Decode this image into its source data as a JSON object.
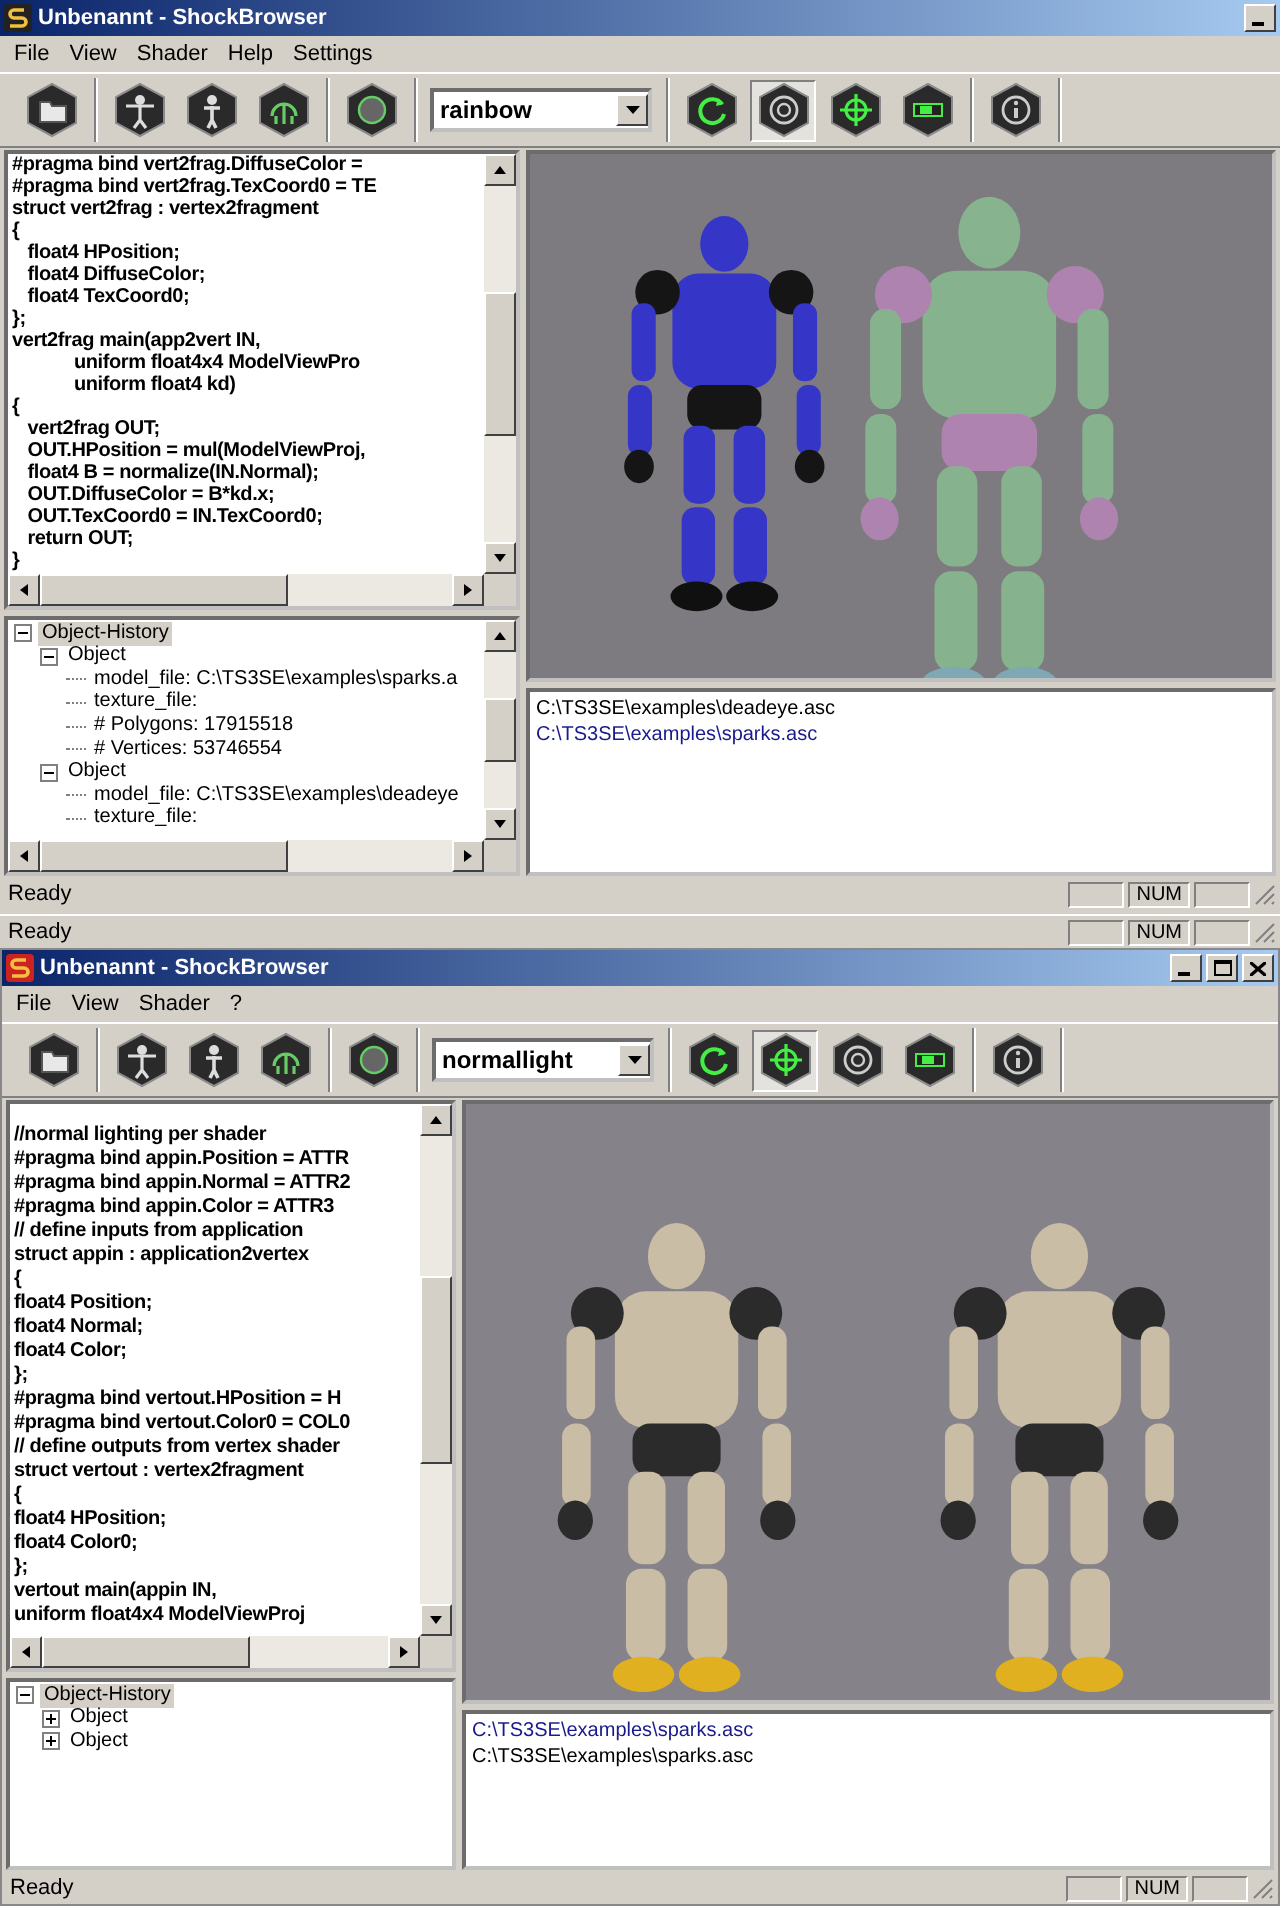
{
  "windows": [
    {
      "title": "Unbenannt - ShockBrowser",
      "caption_buttons": [
        {
          "kind": "minimize"
        }
      ],
      "menu": [
        "File",
        "View",
        "Shader",
        "Help",
        "Settings"
      ],
      "toolbar": [
        {
          "kind": "buttons",
          "buttons": [
            {
              "kind": "folder",
              "pressed": false
            }
          ]
        },
        {
          "kind": "buttons",
          "buttons": [
            {
              "kind": "spread-figure",
              "pressed": false
            },
            {
              "kind": "figure",
              "pressed": false
            },
            {
              "kind": "helmet",
              "pressed": false
            }
          ]
        },
        {
          "kind": "buttons",
          "buttons": [
            {
              "kind": "sphere",
              "pressed": false
            }
          ]
        },
        {
          "kind": "dropdown",
          "value": "rainbow"
        },
        {
          "kind": "buttons",
          "buttons": [
            {
              "kind": "rotate",
              "pressed": false
            },
            {
              "kind": "ring",
              "pressed": true
            },
            {
              "kind": "crosshair",
              "pressed": false
            },
            {
              "kind": "slider",
              "pressed": false
            }
          ]
        },
        {
          "kind": "buttons",
          "buttons": [
            {
              "kind": "info",
              "pressed": false
            }
          ]
        }
      ],
      "code": [
        "#pragma bind vert2frag.DiffuseColor = ",
        "#pragma bind vert2frag.TexCoord0 = TE",
        "struct vert2frag : vertex2fragment",
        "{",
        "   float4 HPosition;",
        "   float4 DiffuseColor;",
        "   float4 TexCoord0;",
        "};",
        "vert2frag main(app2vert IN,",
        "            uniform float4x4 ModelViewPro",
        "            uniform float4 kd)",
        "{",
        "   vert2frag OUT;",
        "   OUT.HPosition = mul(ModelViewProj,",
        "   float4 B = normalize(IN.Normal);",
        "   OUT.DiffuseColor = B*kd.x;",
        "   OUT.TexCoord0 = IN.TexCoord0;",
        "   return OUT;",
        "}"
      ],
      "tree": [
        {
          "label": "Object-History",
          "selected": true,
          "expanded": true,
          "children": [
            {
              "label": "Object",
              "selected": false,
              "expanded": true,
              "children": [
                {
                  "label": "model_file: C:\\TS3SE\\examples\\sparks.a",
                  "selected": false
                },
                {
                  "label": "texture_file:",
                  "selected": false
                },
                {
                  "label": "# Polygons: 17915518",
                  "selected": false
                },
                {
                  "label": "# Vertices: 53746554",
                  "selected": false
                }
              ]
            },
            {
              "label": "Object",
              "selected": false,
              "expanded": true,
              "children": [
                {
                  "label": "model_file: C:\\TS3SE\\examples\\deadeye",
                  "selected": false
                },
                {
                  "label": "texture_file:",
                  "selected": false
                }
              ]
            }
          ]
        }
      ],
      "viewport": {
        "kind": "glow"
      },
      "log": [
        {
          "text": "C:\\TS3SE\\examples\\deadeye.asc",
          "selected": false
        },
        {
          "text": "C:\\TS3SE\\examples\\sparks.asc",
          "selected": true
        }
      ],
      "status": {
        "text": "Ready",
        "indicator": "NUM"
      }
    },
    {
      "title": "Unbenannt - ShockBrowser",
      "caption_buttons": [
        {
          "kind": "minimize"
        },
        {
          "kind": "maximize"
        },
        {
          "kind": "close"
        }
      ],
      "menu": [
        "File",
        "View",
        "Shader",
        "?"
      ],
      "toolbar": [
        {
          "kind": "buttons",
          "buttons": [
            {
              "kind": "folder",
              "pressed": false
            }
          ]
        },
        {
          "kind": "buttons",
          "buttons": [
            {
              "kind": "spread-figure",
              "pressed": false
            },
            {
              "kind": "figure",
              "pressed": false
            },
            {
              "kind": "helmet",
              "pressed": false
            }
          ]
        },
        {
          "kind": "buttons",
          "buttons": [
            {
              "kind": "sphere",
              "pressed": false
            }
          ]
        },
        {
          "kind": "dropdown",
          "value": "normallight"
        },
        {
          "kind": "buttons",
          "buttons": [
            {
              "kind": "rotate",
              "pressed": false
            },
            {
              "kind": "crosshair",
              "pressed": true
            },
            {
              "kind": "ring",
              "pressed": false
            },
            {
              "kind": "slider",
              "pressed": false
            }
          ]
        },
        {
          "kind": "buttons",
          "buttons": [
            {
              "kind": "info",
              "pressed": false
            }
          ]
        }
      ],
      "code": [
        "//normal lighting per shader",
        "#pragma bind appin.Position = ATTR",
        "#pragma bind appin.Normal = ATTR2",
        "#pragma bind appin.Color = ATTR3",
        "// define inputs from application",
        "struct appin : application2vertex",
        "{",
        "float4 Position;",
        "float4 Normal;",
        "float4 Color;",
        "};",
        "#pragma bind vertout.HPosition = H",
        "#pragma bind vertout.Color0 = COL0",
        "// define outputs from vertex shader",
        "struct vertout : vertex2fragment",
        "{",
        "float4 HPosition;",
        "float4 Color0;",
        "};",
        "vertout main(appin IN,",
        "uniform float4x4 ModelViewProj"
      ],
      "tree": [
        {
          "label": "Object-History",
          "selected": true,
          "expanded": true,
          "children": [
            {
              "label": "Object",
              "selected": false,
              "expanded": false
            },
            {
              "label": "Object",
              "selected": false,
              "expanded": false
            }
          ]
        }
      ],
      "viewport": {
        "kind": "matte"
      },
      "log": [
        {
          "text": "C:\\TS3SE\\examples\\sparks.asc",
          "selected": true
        },
        {
          "text": "C:\\TS3SE\\examples\\sparks.asc",
          "selected": false
        }
      ],
      "status": {
        "text": "Ready",
        "indicator": "NUM"
      }
    }
  ],
  "background_window": {
    "status": "Ready",
    "indicator": "NUM"
  }
}
